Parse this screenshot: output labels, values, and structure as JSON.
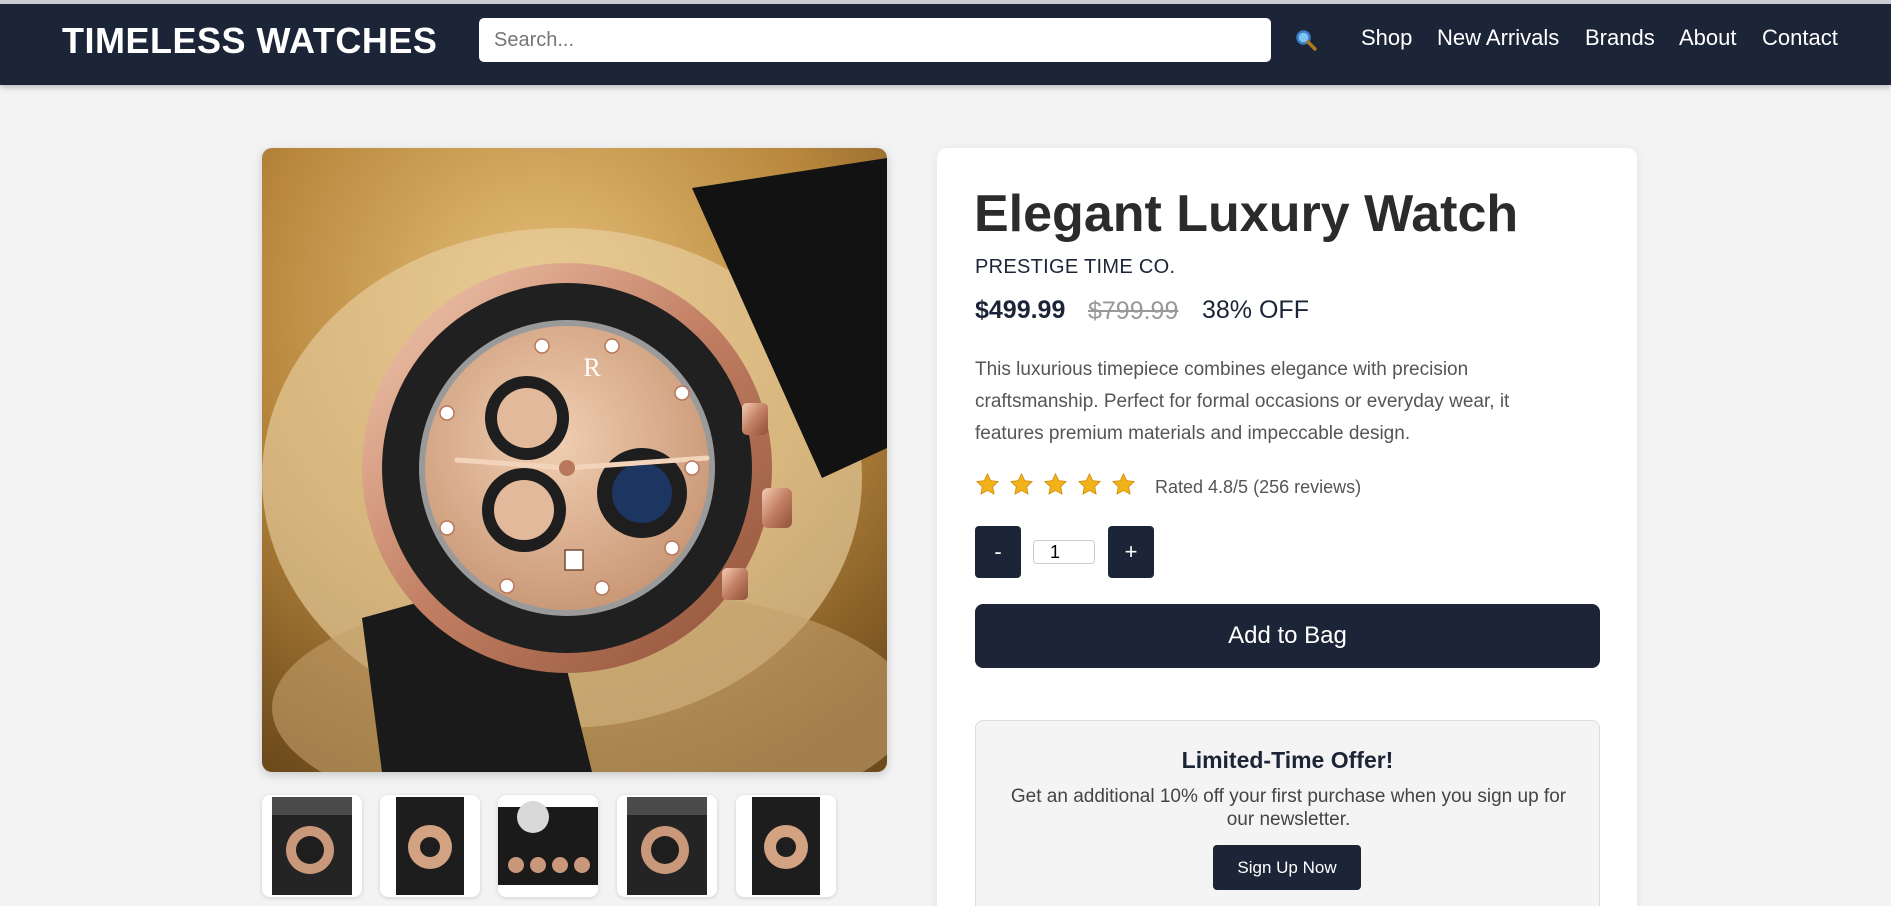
{
  "header": {
    "logo": "TIMELESS WATCHES",
    "search_placeholder": "Search...",
    "search_icon": "magnifier-icon",
    "nav": [
      "Shop",
      "New Arrivals",
      "Brands",
      "About",
      "Contact"
    ]
  },
  "product": {
    "title": "Elegant Luxury Watch",
    "brand": "PRESTIGE TIME CO.",
    "price": "$499.99",
    "old_price": "$799.99",
    "discount": "38% OFF",
    "description": "This luxurious timepiece combines elegance with precision craftsmanship. Perfect for formal occasions or everyday wear, it features premium materials and impeccable design.",
    "stars": 5,
    "rating_text": "Rated 4.8/5 (256 reviews)",
    "quantity": "1",
    "minus_label": "-",
    "plus_label": "+",
    "add_to_bag_label": "Add to Bag",
    "thumbnail_count": 5
  },
  "offer": {
    "title": "Limited-Time Offer!",
    "text": "Get an additional 10% off your first purchase when you sign up for our newsletter.",
    "button_label": "Sign Up Now"
  },
  "colors": {
    "navy": "#1c2537",
    "background": "#f3f3f3",
    "star": "#f2b31a"
  }
}
